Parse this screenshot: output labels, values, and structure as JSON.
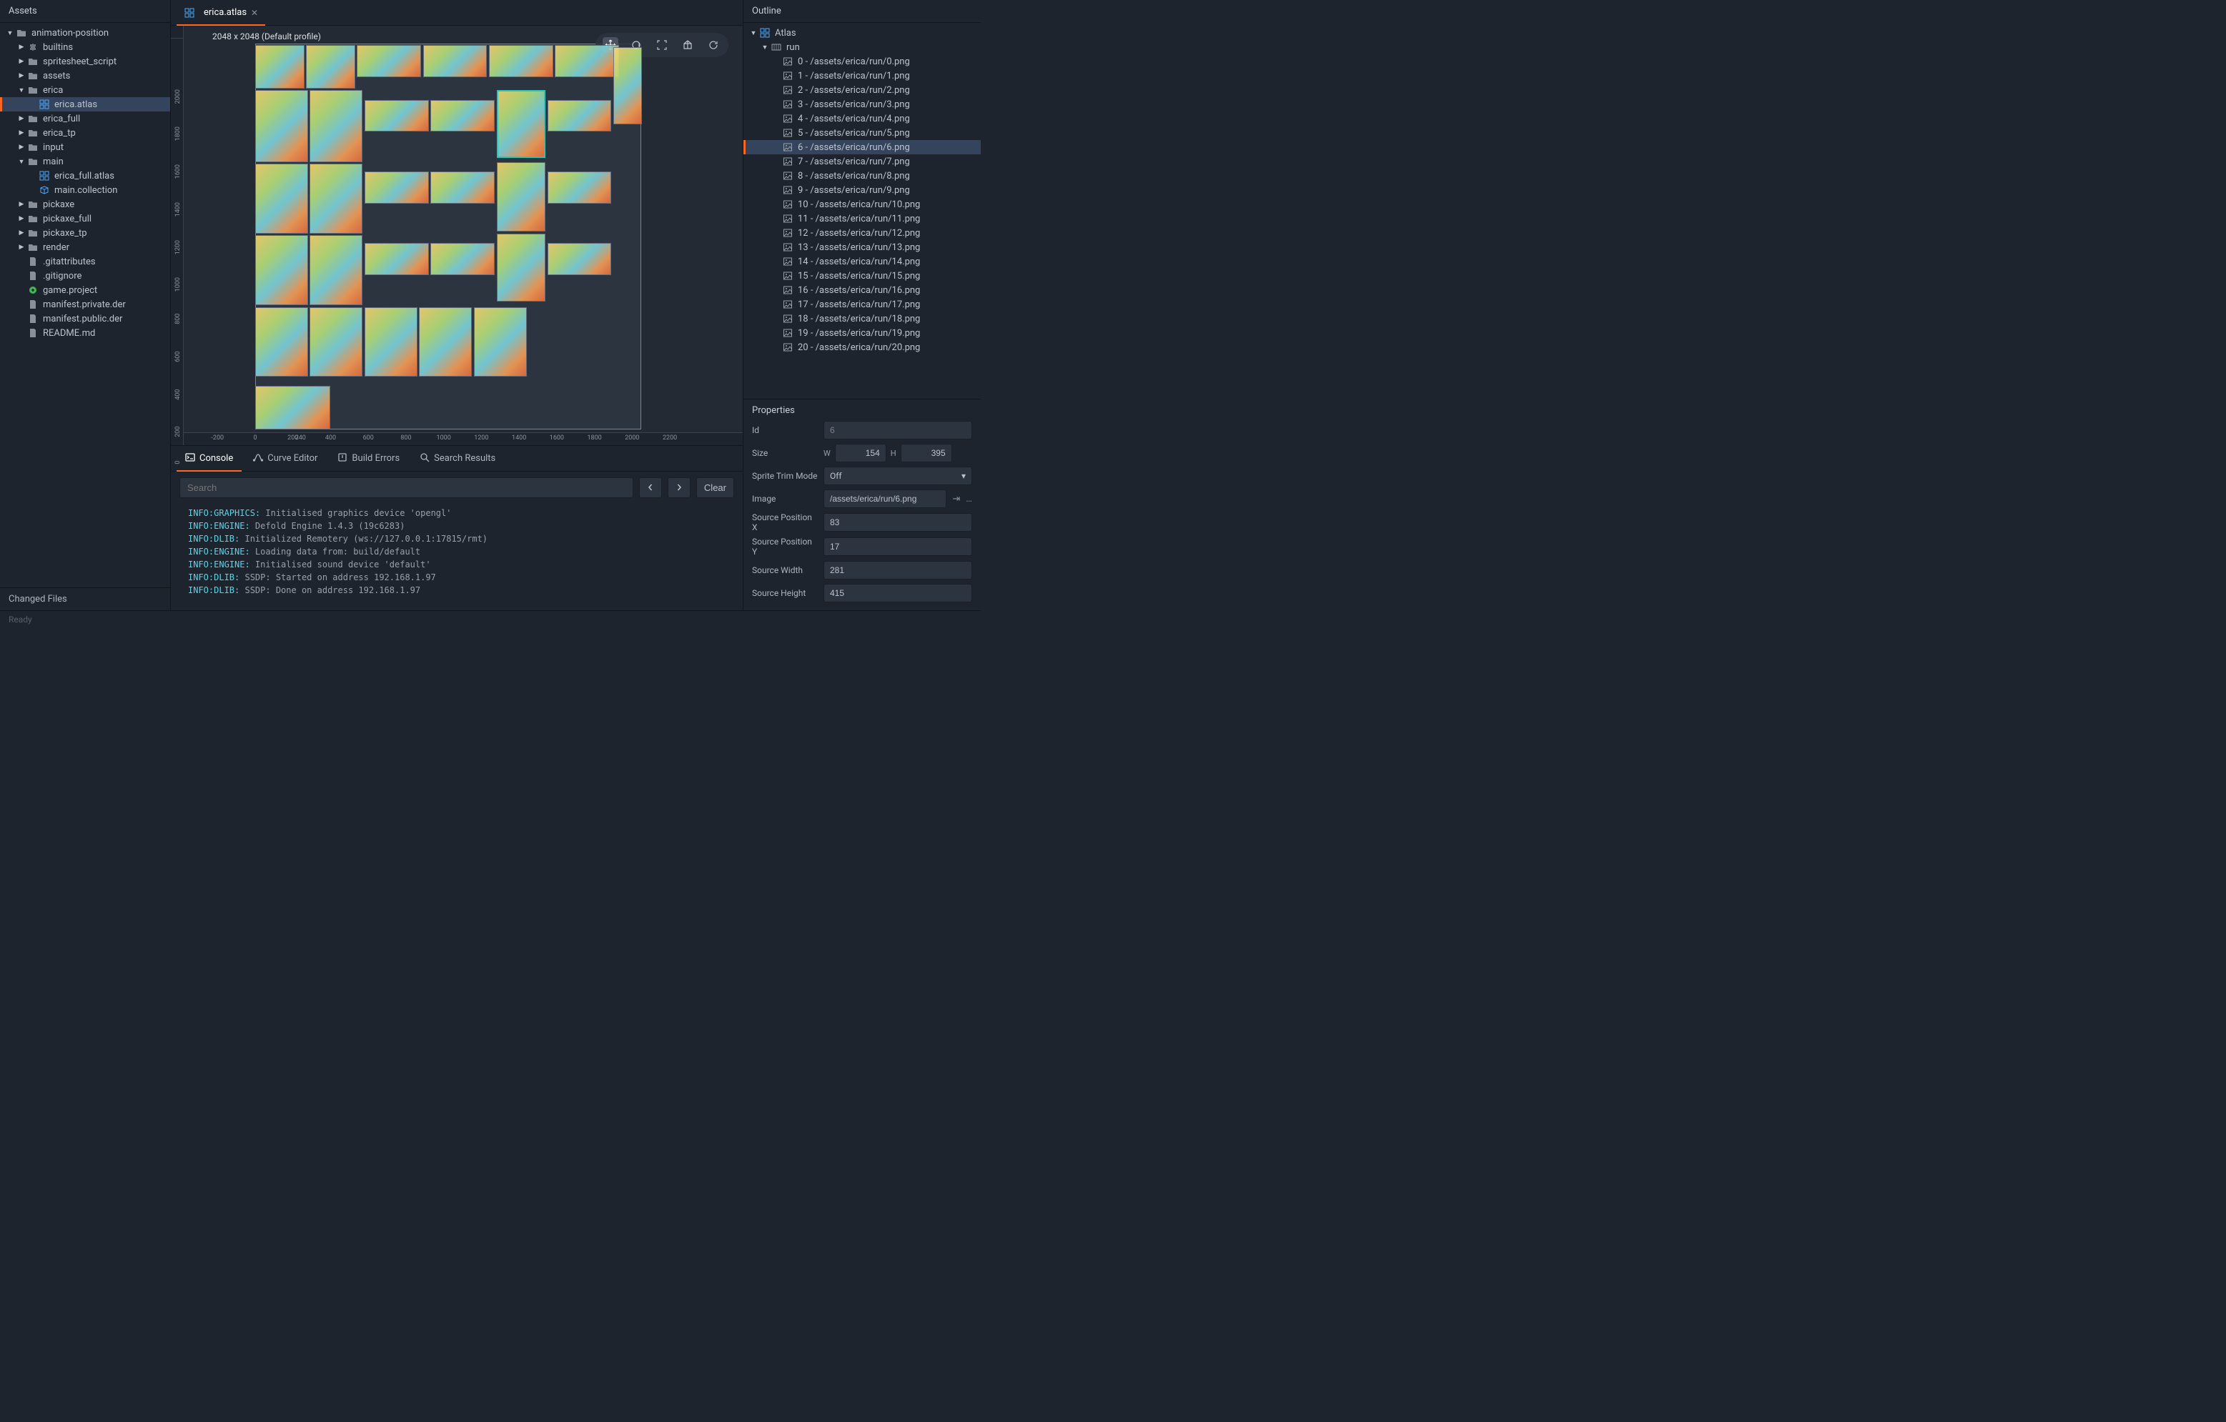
{
  "assets": {
    "title": "Assets",
    "tree": [
      {
        "depth": 0,
        "caret": "down",
        "icon": "folder",
        "label": "animation-position",
        "sel": false
      },
      {
        "depth": 1,
        "caret": "right",
        "icon": "puzzle",
        "label": "builtins",
        "sel": false
      },
      {
        "depth": 1,
        "caret": "right",
        "icon": "folder",
        "label": "spritesheet_script",
        "sel": false
      },
      {
        "depth": 1,
        "caret": "right",
        "icon": "folder",
        "label": "assets",
        "sel": false
      },
      {
        "depth": 1,
        "caret": "down",
        "icon": "folder",
        "label": "erica",
        "sel": false
      },
      {
        "depth": 2,
        "caret": "none",
        "icon": "atlas",
        "label": "erica.atlas",
        "sel": true
      },
      {
        "depth": 1,
        "caret": "right",
        "icon": "folder",
        "label": "erica_full",
        "sel": false
      },
      {
        "depth": 1,
        "caret": "right",
        "icon": "folder",
        "label": "erica_tp",
        "sel": false
      },
      {
        "depth": 1,
        "caret": "right",
        "icon": "folder",
        "label": "input",
        "sel": false
      },
      {
        "depth": 1,
        "caret": "down",
        "icon": "folder",
        "label": "main",
        "sel": false
      },
      {
        "depth": 2,
        "caret": "none",
        "icon": "atlas",
        "label": "erica_full.atlas",
        "sel": false
      },
      {
        "depth": 2,
        "caret": "none",
        "icon": "collection",
        "label": "main.collection",
        "sel": false
      },
      {
        "depth": 1,
        "caret": "right",
        "icon": "folder",
        "label": "pickaxe",
        "sel": false
      },
      {
        "depth": 1,
        "caret": "right",
        "icon": "folder",
        "label": "pickaxe_full",
        "sel": false
      },
      {
        "depth": 1,
        "caret": "right",
        "icon": "folder",
        "label": "pickaxe_tp",
        "sel": false
      },
      {
        "depth": 1,
        "caret": "right",
        "icon": "folder",
        "label": "render",
        "sel": false
      },
      {
        "depth": 1,
        "caret": "none",
        "icon": "file",
        "label": ".gitattributes",
        "sel": false
      },
      {
        "depth": 1,
        "caret": "none",
        "icon": "file",
        "label": ".gitignore",
        "sel": false
      },
      {
        "depth": 1,
        "caret": "none",
        "icon": "project",
        "label": "game.project",
        "sel": false
      },
      {
        "depth": 1,
        "caret": "none",
        "icon": "file",
        "label": "manifest.private.der",
        "sel": false
      },
      {
        "depth": 1,
        "caret": "none",
        "icon": "file",
        "label": "manifest.public.der",
        "sel": false
      },
      {
        "depth": 1,
        "caret": "none",
        "icon": "file",
        "label": "README.md",
        "sel": false
      }
    ]
  },
  "editor": {
    "tab_label": "erica.atlas",
    "overlay": "2048 x 2048 (Default profile)",
    "ruler_h": [
      "0",
      "200",
      "400",
      "600",
      "800",
      "1000",
      "1200",
      "1400",
      "1600",
      "1800",
      "2000",
      "2200",
      "240"
    ],
    "ruler_h_neg": [
      "-200"
    ],
    "ruler_v": [
      "0",
      "200",
      "400",
      "600",
      "800",
      "1000",
      "1200",
      "1400",
      "1600",
      "1800",
      "2000"
    ],
    "tools": [
      "move",
      "rotate",
      "frame",
      "perspective",
      "refresh"
    ]
  },
  "bottom": {
    "tabs": [
      "Console",
      "Curve Editor",
      "Build Errors",
      "Search Results"
    ],
    "active": 0,
    "search_placeholder": "Search",
    "clear": "Clear",
    "log": [
      {
        "tag": "INFO:GRAPHICS:",
        "msg": " Initialised graphics device 'opengl'"
      },
      {
        "tag": "INFO:ENGINE:",
        "msg": " Defold Engine 1.4.3 (19c6283)"
      },
      {
        "tag": "INFO:DLIB:",
        "msg": " Initialized Remotery (ws://127.0.0.1:17815/rmt)"
      },
      {
        "tag": "INFO:ENGINE:",
        "msg": " Loading data from: build/default"
      },
      {
        "tag": "INFO:ENGINE:",
        "msg": " Initialised sound device 'default'"
      },
      {
        "tag": "INFO:DLIB:",
        "msg": " SSDP: Started on address 192.168.1.97"
      },
      {
        "tag": "INFO:DLIB:",
        "msg": " SSDP: Done on address 192.168.1.97"
      }
    ]
  },
  "outline": {
    "title": "Outline",
    "root": "Atlas",
    "anim": "run",
    "selected_index": 6,
    "frames": [
      "0 - /assets/erica/run/0.png",
      "1 - /assets/erica/run/1.png",
      "2 - /assets/erica/run/2.png",
      "3 - /assets/erica/run/3.png",
      "4 - /assets/erica/run/4.png",
      "5 - /assets/erica/run/5.png",
      "6 - /assets/erica/run/6.png",
      "7 - /assets/erica/run/7.png",
      "8 - /assets/erica/run/8.png",
      "9 - /assets/erica/run/9.png",
      "10 - /assets/erica/run/10.png",
      "11 - /assets/erica/run/11.png",
      "12 - /assets/erica/run/12.png",
      "13 - /assets/erica/run/13.png",
      "14 - /assets/erica/run/14.png",
      "15 - /assets/erica/run/15.png",
      "16 - /assets/erica/run/16.png",
      "17 - /assets/erica/run/17.png",
      "18 - /assets/erica/run/18.png",
      "19 - /assets/erica/run/19.png",
      "20 - /assets/erica/run/20.png"
    ]
  },
  "properties": {
    "title": "Properties",
    "id_label": "Id",
    "id_value": "6",
    "size_label": "Size",
    "w_label": "W",
    "w_value": "154",
    "h_label": "H",
    "h_value": "395",
    "trim_label": "Sprite Trim Mode",
    "trim_value": "Off",
    "image_label": "Image",
    "image_value": "/assets/erica/run/6.png",
    "spx_label": "Source Position X",
    "spx_value": "83",
    "spy_label": "Source Position Y",
    "spy_value": "17",
    "sw_label": "Source Width",
    "sw_value": "281",
    "sh_label": "Source Height",
    "sh_value": "415"
  },
  "changed_files": "Changed Files",
  "status": "Ready"
}
